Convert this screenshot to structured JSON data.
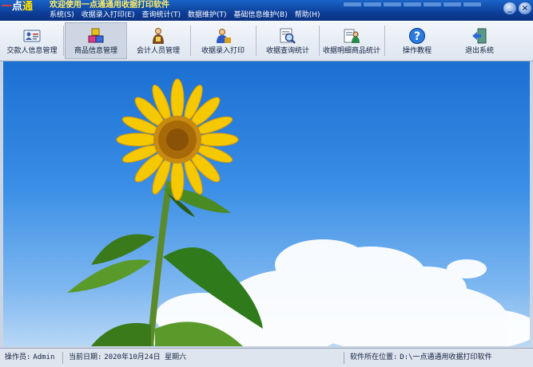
{
  "app": {
    "logo": "一点通",
    "title": "欢迎使用一点通通用收据打印软件"
  },
  "menu": [
    "系统(S)",
    "收据录入打印(E)",
    "查询统计(T)",
    "数据维护(T)",
    "基础信息维护(B)",
    "帮助(H)"
  ],
  "window_buttons": {
    "minimize": "_",
    "close": "×"
  },
  "toolbar": {
    "buttons": [
      {
        "label": "交款人信息管理",
        "icon": "person-card-icon"
      },
      {
        "label": "商品信息管理",
        "icon": "cubes-icon"
      },
      {
        "label": "会计人员管理",
        "icon": "accountant-icon"
      },
      {
        "label": "收据录入打印",
        "icon": "person-print-icon"
      },
      {
        "label": "收据查询统计",
        "icon": "magnifier-doc-icon"
      },
      {
        "label": "收据明细商品统计",
        "icon": "doc-person-icon"
      },
      {
        "label": "操作教程",
        "icon": "help-icon"
      },
      {
        "label": "退出系统",
        "icon": "exit-icon"
      }
    ]
  },
  "status": {
    "operator_label": "操作员:",
    "operator": "Admin",
    "date_label": "当前日期:",
    "date": "2020年10月24日 星期六",
    "path_label": "软件所在位置:",
    "path": "D:\\一点通通用收据打印软件"
  },
  "colors": {
    "titlebar": "#0d3f9a",
    "title_text": "#ffee66",
    "sky": "#3b8fe6",
    "petal": "#f5c800"
  }
}
